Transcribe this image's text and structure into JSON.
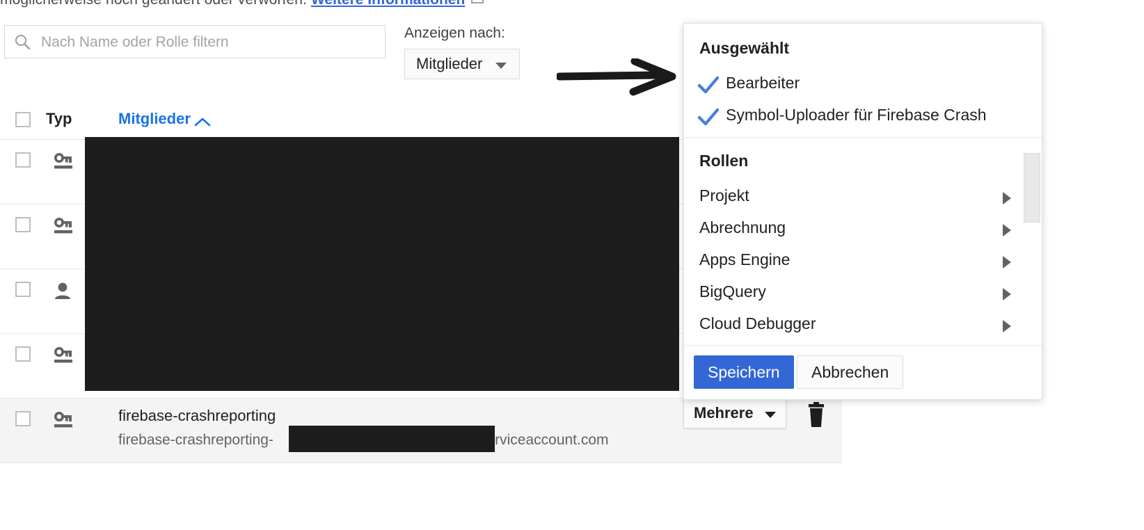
{
  "notice": {
    "text": "möglicherweise noch geändert oder verworfen.",
    "link": "Weitere Informationen",
    "external_icon": "external-link-icon"
  },
  "filter": {
    "icon": "search-icon",
    "value": "",
    "placeholder": "Nach Name oder Rolle filtern"
  },
  "view_by": {
    "label": "Anzeigen nach:",
    "selected": "Mitglieder",
    "caret_icon": "chevron-down-icon"
  },
  "annotation": {
    "arrow_icon": "hand-drawn-right-arrow-icon"
  },
  "table": {
    "headers": {
      "select_all": "",
      "type": "Typ",
      "member": "Mitglieder",
      "sort_indicator": "︿"
    },
    "rows": [
      {
        "type_icon": "service-account-key-icon",
        "name": "",
        "email": "",
        "redacted": true,
        "highlight": false
      },
      {
        "type_icon": "service-account-key-icon",
        "name": "",
        "email": "",
        "redacted": true,
        "highlight": false
      },
      {
        "type_icon": "person-icon",
        "name": "",
        "email": "",
        "redacted": true,
        "highlight": false
      },
      {
        "type_icon": "service-account-key-icon",
        "name": "",
        "email": "",
        "redacted": true,
        "highlight": false
      },
      {
        "type_icon": "service-account-key-icon",
        "name": "firebase-crashreporting",
        "email_prefix": "firebase-crashreporting-",
        "email_suffix": "serviceaccount.com",
        "redacted": false,
        "highlight": true
      }
    ]
  },
  "row_role_control": {
    "label": "Mehrere",
    "caret_icon": "chevron-down-icon",
    "delete_icon": "trash-icon"
  },
  "role_picker": {
    "selected_title": "Ausgewählt",
    "selected_items": [
      {
        "label": "Bearbeiter",
        "checked": true,
        "check_icon": "check-icon"
      },
      {
        "label": "Symbol-Uploader für Firebase Crash",
        "checked": true,
        "check_icon": "check-icon"
      }
    ],
    "roles_title": "Rollen",
    "roles": [
      {
        "label": "Projekt",
        "arrow_icon": "chevron-right-icon"
      },
      {
        "label": "Abrechnung",
        "arrow_icon": "chevron-right-icon"
      },
      {
        "label": "Apps Engine",
        "arrow_icon": "chevron-right-icon"
      },
      {
        "label": "BigQuery",
        "arrow_icon": "chevron-right-icon"
      },
      {
        "label": "Cloud Debugger",
        "arrow_icon": "chevron-right-icon"
      }
    ],
    "save_label": "Speichern",
    "cancel_label": "Abbrechen",
    "accent_color": "#3367d6",
    "scrollbar": "vertical-scrollbar"
  }
}
